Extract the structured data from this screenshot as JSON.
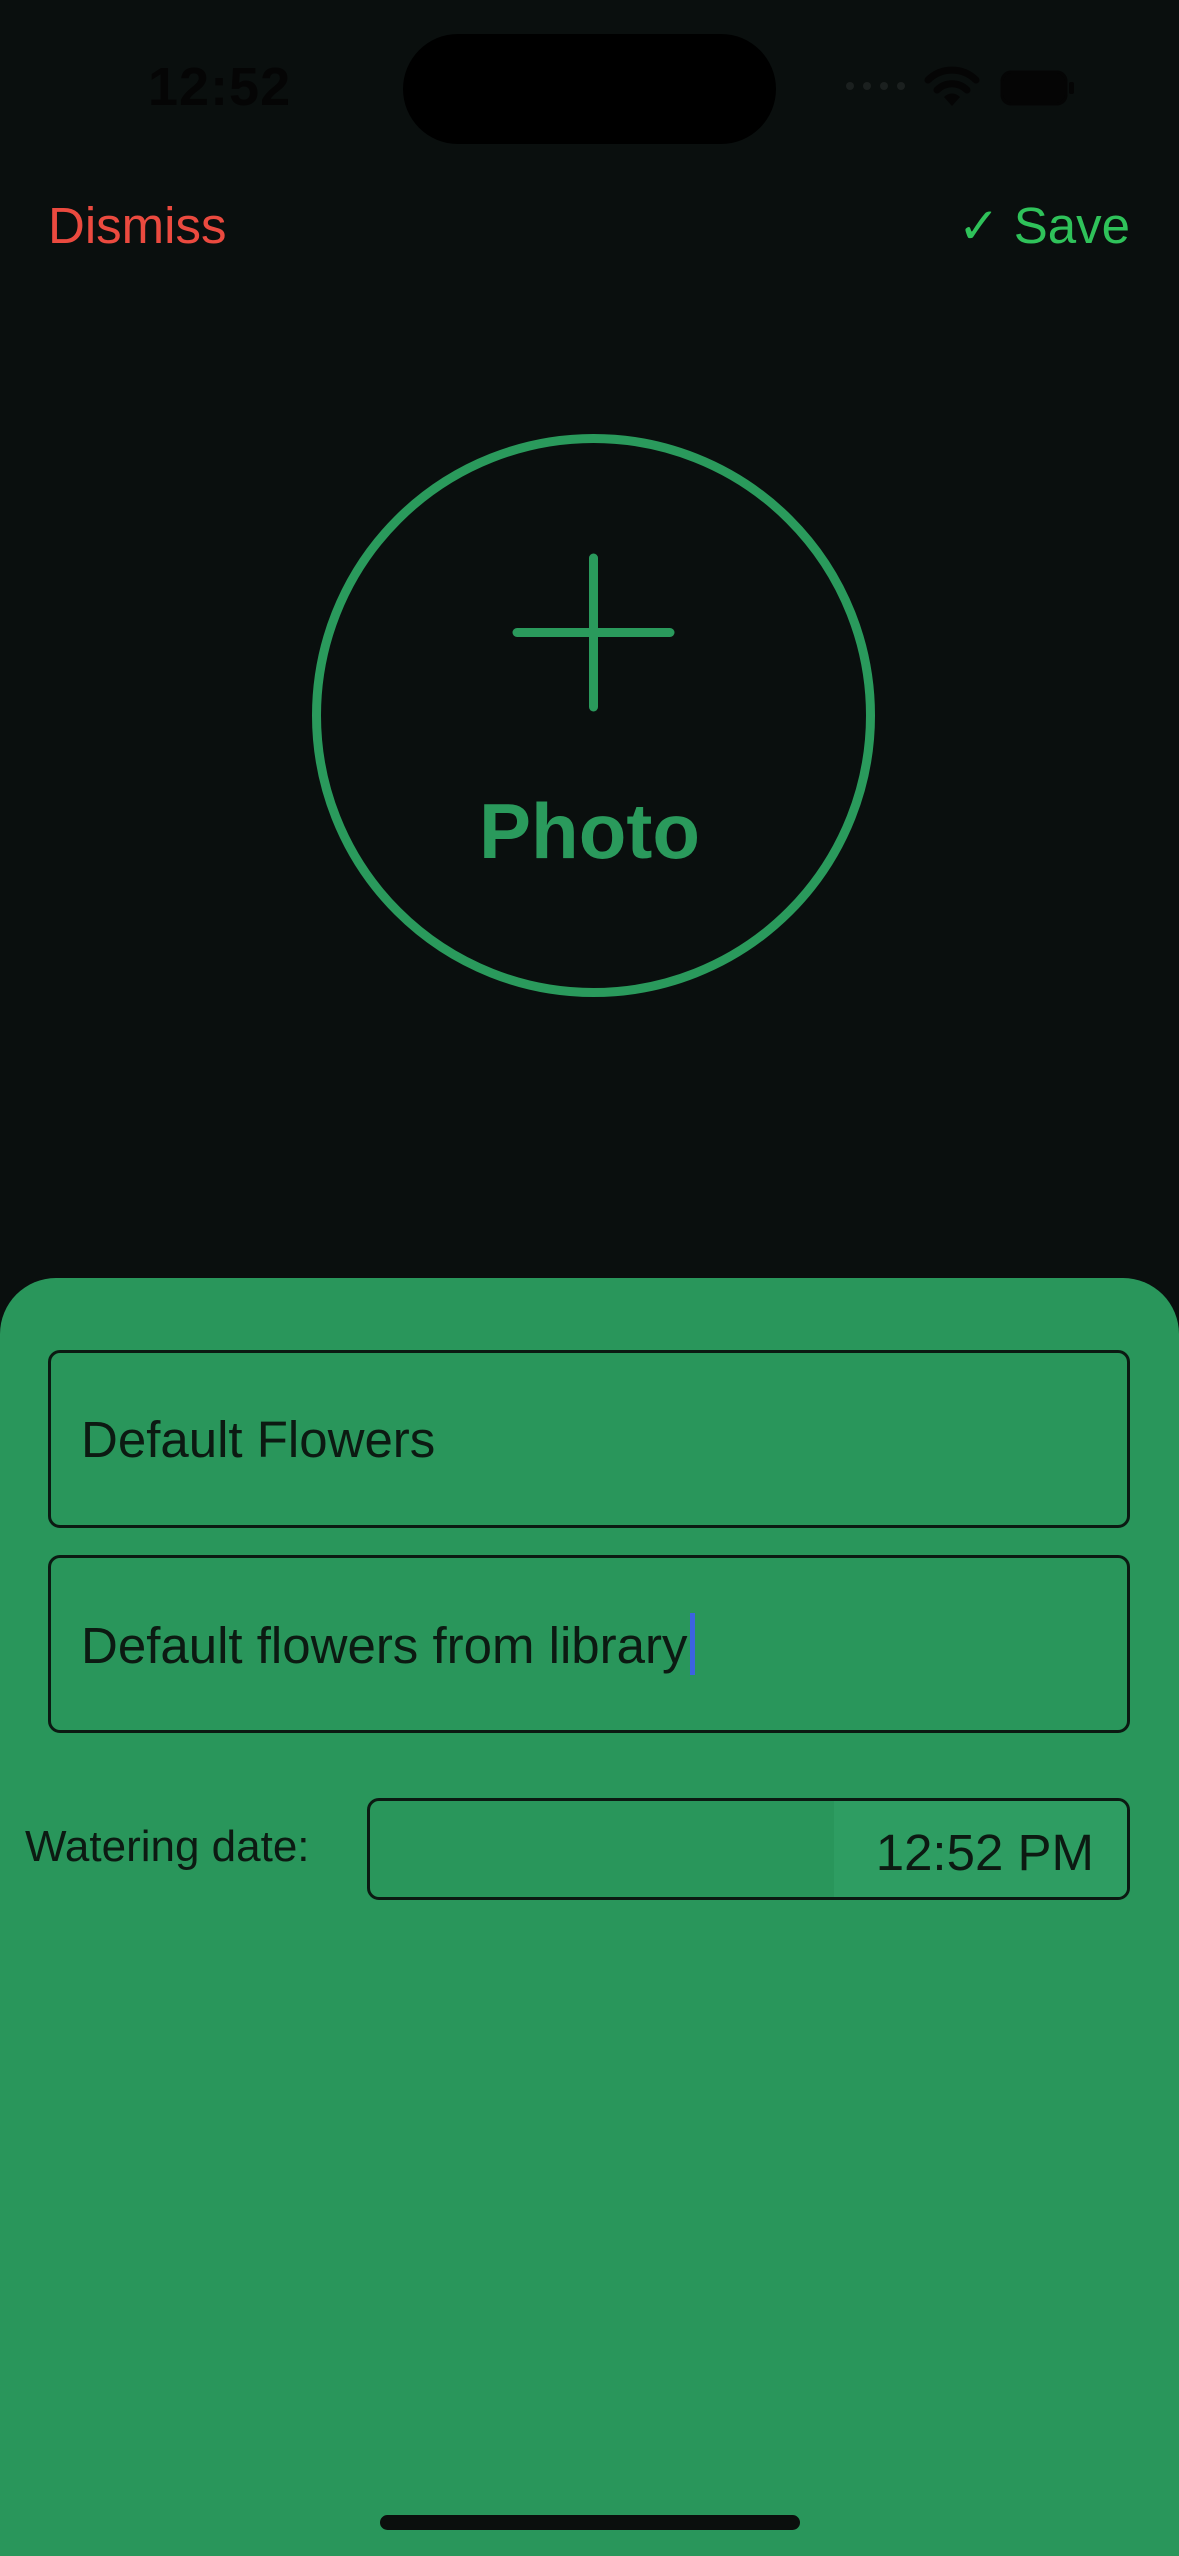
{
  "status_bar": {
    "time": "12:52",
    "icons": [
      "cellular-signal-icon",
      "wifi-icon",
      "battery-icon"
    ]
  },
  "nav": {
    "dismiss_label": "Dismiss",
    "save_label": "Save",
    "save_icon": "checkmark-icon",
    "save_icon_glyph": "✓"
  },
  "photo_picker": {
    "label": "Photo",
    "icon": "plus-icon"
  },
  "form": {
    "name_value": "Default Flowers",
    "description_value": "Default flowers from library",
    "watering_label": "Watering date:",
    "watering_time": "12:52 PM"
  },
  "colors": {
    "background": "#0a0f0e",
    "sheet": "#29965b",
    "accent_green": "#2fc25a",
    "photo_green": "#2a9a5c",
    "dismiss_red": "#eb4a3f",
    "cursor_blue": "#3c63e0"
  }
}
